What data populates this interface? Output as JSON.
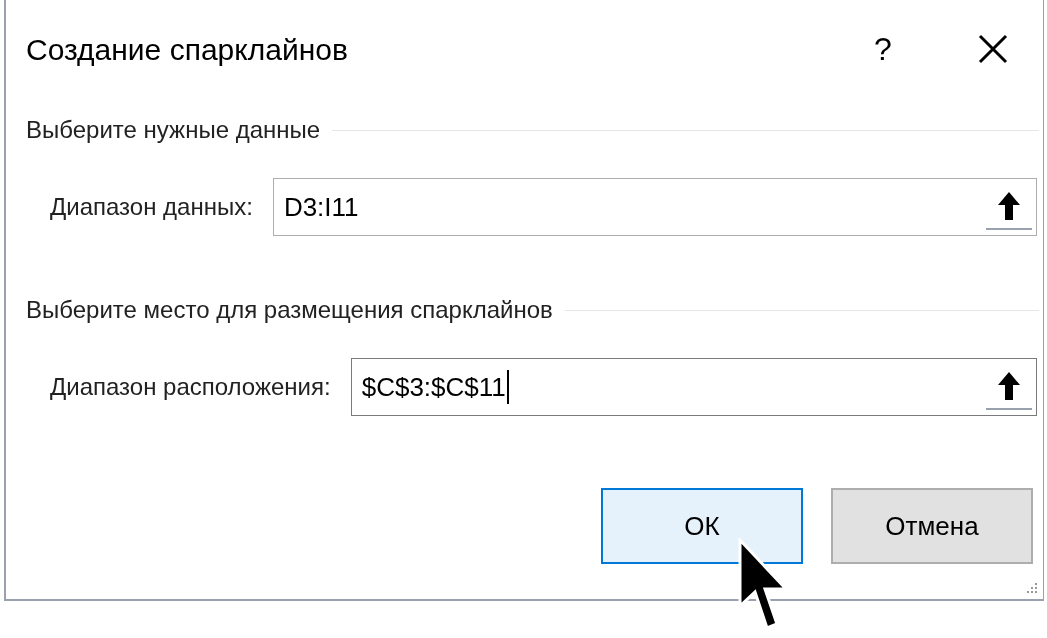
{
  "window": {
    "title": "Создание спарклайнов",
    "help": "?"
  },
  "groups": [
    {
      "heading": "Выберите нужные данные",
      "field": {
        "label": "Диапазон данных:",
        "value": "D3:I11",
        "focused": false
      }
    },
    {
      "heading": "Выберите место для размещения спарклайнов",
      "field": {
        "label": "Диапазон расположения:",
        "value": "$C$3:$C$11",
        "focused": true
      }
    }
  ],
  "buttons": [
    {
      "label": "ОК",
      "default": true
    },
    {
      "label": "Отмена",
      "default": false
    }
  ]
}
